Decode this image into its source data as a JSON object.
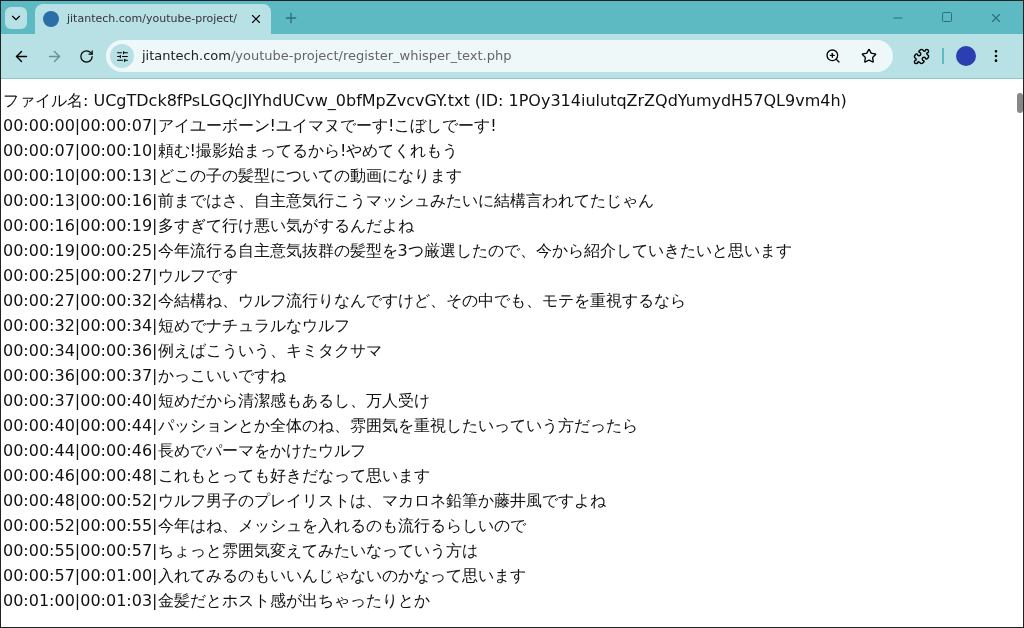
{
  "tab": {
    "title": "jitantech.com/youtube-project/",
    "selected": true
  },
  "address": {
    "host": "jitantech.com",
    "path": "/youtube-project/register_whisper_text.php"
  },
  "header": "ファイル名: UCgTDck8fPsLGQcJIYhdUCvw_0bfMpZvcvGY.txt (ID: 1POy314iulutqZrZQdYumydH57QL9vm4h)",
  "lines": [
    "00:00:00|00:00:07|アイユーボーン!ユイマヌでーす!こぼしでーす!",
    "00:00:07|00:00:10|頼む!撮影始まってるから!やめてくれもう",
    "00:00:10|00:00:13|どこの子の髪型についての動画になります",
    "00:00:13|00:00:16|前まではさ、自主意気行こうマッシュみたいに結構言われてたじゃん",
    "00:00:16|00:00:19|多すぎて行け悪い気がするんだよね",
    "00:00:19|00:00:25|今年流行る自主意気抜群の髪型を3つ厳選したので、今から紹介していきたいと思います",
    "00:00:25|00:00:27|ウルフです",
    "00:00:27|00:00:32|今結構ね、ウルフ流行りなんですけど、その中でも、モテを重視するなら",
    "00:00:32|00:00:34|短めでナチュラルなウルフ",
    "00:00:34|00:00:36|例えばこういう、キミタクサマ",
    "00:00:36|00:00:37|かっこいいですね",
    "00:00:37|00:00:40|短めだから清潔感もあるし、万人受け",
    "00:00:40|00:00:44|パッションとか全体のね、雰囲気を重視したいっていう方だったら",
    "00:00:44|00:00:46|長めでパーマをかけたウルフ",
    "00:00:46|00:00:48|これもとっても好きだなって思います",
    "00:00:48|00:00:52|ウルフ男子のプレイリストは、マカロネ鉛筆か藤井風ですよね",
    "00:00:52|00:00:55|今年はね、メッシュを入れるのも流行るらしいので",
    "00:00:55|00:00:57|ちょっと雰囲気変えてみたいなっていう方は",
    "00:00:57|00:01:00|入れてみるのもいいんじゃないのかなって思います",
    "00:01:00|00:01:03|金髪だとホスト感が出ちゃったりとか"
  ]
}
